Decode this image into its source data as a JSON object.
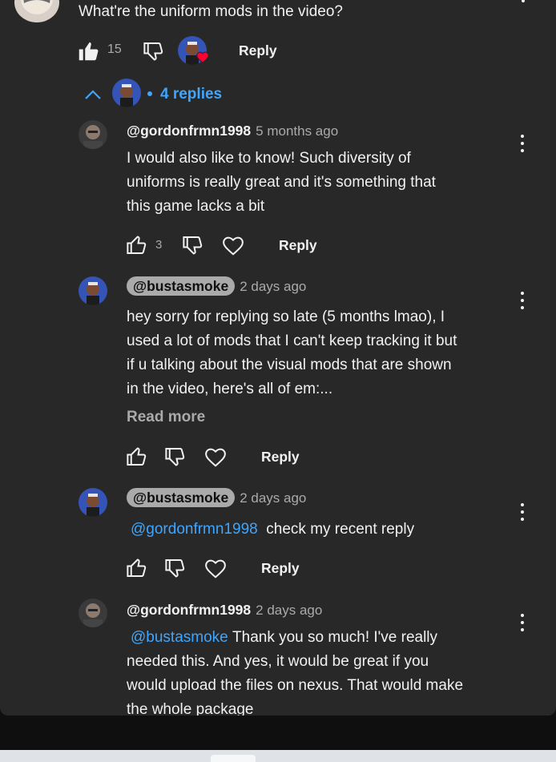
{
  "top_comment": {
    "text": "What're the uniform mods in the video?",
    "likes": "15",
    "reply_label": "Reply"
  },
  "replies_toggle": {
    "label": "4 replies"
  },
  "replies": [
    {
      "handle": "@gordonfrmn1998",
      "time": "5 months ago",
      "lines": [
        "I would also like to know! Such diversity of",
        "uniforms is really great and it's something that",
        "this game lacks a bit"
      ],
      "likes": "3",
      "reply_label": "Reply"
    },
    {
      "handle": "@bustasmoke",
      "time": "2 days ago",
      "lines": [
        "hey sorry for replying so late (5 months lmao), I",
        "used a lot of mods that I can't keep tracking it but",
        "if u talking about the visual mods that are shown",
        "in the video, here's all of em:..."
      ],
      "read_more": "Read more",
      "reply_label": "Reply"
    },
    {
      "handle": "@bustasmoke",
      "time": "2 days ago",
      "mention": "@gordonfrmn1998",
      "text": "check my recent reply",
      "reply_label": "Reply"
    },
    {
      "handle": "@gordonfrmn1998",
      "time": "2 days ago",
      "mention": "@bustasmoke",
      "first_line": "Thank you so much! I've really",
      "lines": [
        "needed this. And yes, it would be great if you",
        "would upload the files on nexus. That would make",
        "the whole package"
      ]
    }
  ],
  "colors": {
    "background": "#282828",
    "link": "#3ea6ff",
    "muted": "#aaaaaa",
    "heart": "#ff0033"
  }
}
